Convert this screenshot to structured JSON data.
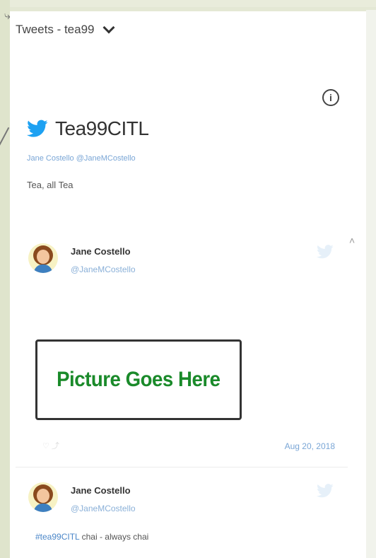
{
  "widget": {
    "header_title": "Tweets - tea99"
  },
  "profile": {
    "name": "Tea99CITL",
    "byline": "Jane Costello @JaneMCostello",
    "description": "Tea, all Tea"
  },
  "tweets": [
    {
      "author": "Jane Costello",
      "handle": "@JaneMCostello",
      "picture_placeholder": "Picture Goes Here",
      "date": "Aug 20, 2018"
    },
    {
      "author": "Jane Costello",
      "handle": "@JaneMCostello",
      "hashtag": "#tea99CITL",
      "text": " chai - always chai"
    }
  ],
  "icons": {
    "dropdown": "chevron-down-icon",
    "info": "info-icon",
    "brand": "twitter-bird-icon"
  },
  "colors": {
    "twitter_blue": "#1da1f2",
    "link_blue": "#7aa6d6",
    "placeholder_green": "#1a8a2a"
  }
}
